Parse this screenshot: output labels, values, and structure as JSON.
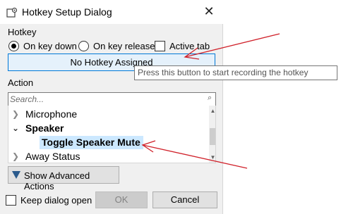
{
  "window": {
    "title": "Hotkey Setup Dialog",
    "close_glyph": "✕"
  },
  "hotkey": {
    "section_label": "Hotkey",
    "on_key_down_label": "On key down",
    "on_key_down_selected": true,
    "on_key_release_label": "On key release",
    "on_key_release_selected": false,
    "active_tab_label": "Active tab",
    "active_tab_checked": false,
    "assign_button_label": "No Hotkey Assigned",
    "tooltip": "Press this button to start recording the hotkey"
  },
  "action": {
    "section_label": "Action",
    "search_placeholder": "Search...",
    "tree": [
      {
        "label": "Microphone",
        "expanded": false,
        "level": 0,
        "bold": false
      },
      {
        "label": "Speaker",
        "expanded": true,
        "level": 0,
        "bold": true
      },
      {
        "label": "Toggle Speaker Mute",
        "level": 1,
        "bold": true,
        "selected": true
      },
      {
        "label": "Away Status",
        "expanded": false,
        "level": 0,
        "bold": false
      }
    ],
    "advanced_button_label": "Show Advanced Actions"
  },
  "footer": {
    "keep_open_label": "Keep dialog open",
    "keep_open_checked": false,
    "ok_label": "OK",
    "ok_enabled": false,
    "cancel_label": "Cancel"
  },
  "colors": {
    "accent_border": "#0078d7",
    "selected_bg": "#cce8ff",
    "annotation_arrow": "#d0212a"
  }
}
